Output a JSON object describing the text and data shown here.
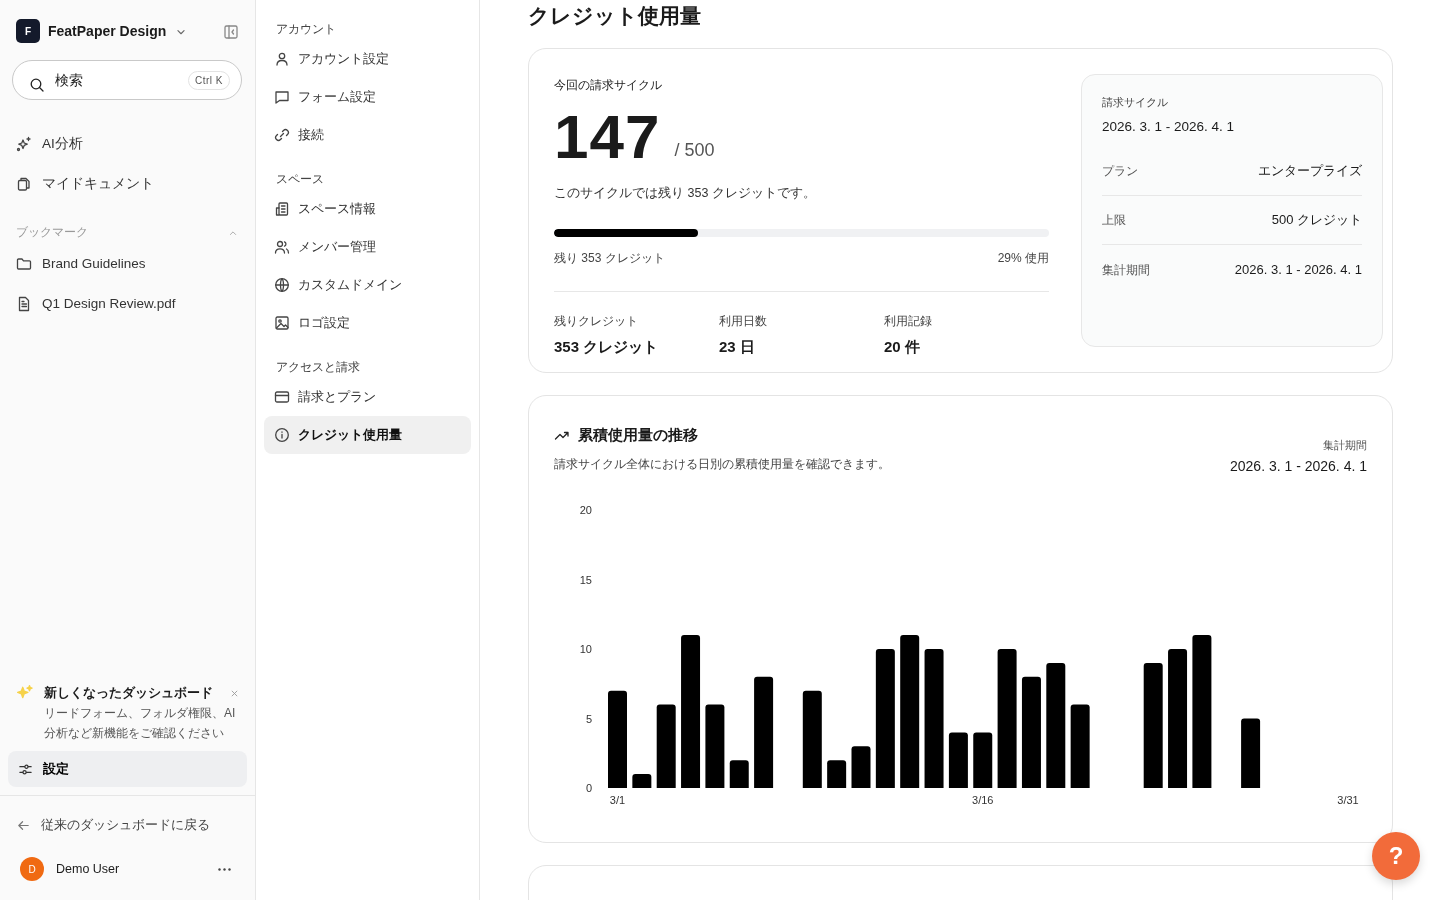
{
  "sidebar": {
    "workspace": {
      "initial": "F",
      "name": "FeatPaper Design"
    },
    "search": {
      "placeholder": "検索",
      "shortcut": "Ctrl K"
    },
    "nav": [
      {
        "label": "AI分析"
      },
      {
        "label": "マイドキュメント"
      }
    ],
    "bookmarks": {
      "title": "ブックマーク",
      "expanded": true,
      "items": [
        {
          "label": "Brand Guidelines"
        },
        {
          "label": "Q1 Design Review.pdf"
        }
      ]
    },
    "notice": {
      "title": "新しくなったダッシュボード",
      "body": "リードフォーム、フォルダ権限、AI分析など新機能をご確認ください"
    },
    "settings": {
      "label": "設定",
      "selected": true
    },
    "back": "従来のダッシュボードに戻る",
    "user": {
      "initial": "D",
      "name": "Demo User"
    }
  },
  "settings_nav": [
    {
      "title": "アカウント",
      "items": [
        {
          "label": "アカウント設定",
          "selected": false
        },
        {
          "label": "フォーム設定",
          "selected": false
        },
        {
          "label": "接続",
          "selected": false
        }
      ]
    },
    {
      "title": "スペース",
      "items": [
        {
          "label": "スペース情報",
          "selected": false
        },
        {
          "label": "メンバー管理",
          "selected": false
        },
        {
          "label": "カスタムドメイン",
          "selected": false
        },
        {
          "label": "ロゴ設定",
          "selected": false
        }
      ]
    },
    {
      "title": "アクセスと請求",
      "items": [
        {
          "label": "請求とプラン",
          "selected": false
        },
        {
          "label": "クレジット使用量",
          "selected": true
        }
      ]
    }
  ],
  "main": {
    "title": "クレジット使用量",
    "usage": {
      "label": "今回の請求サイクル",
      "used": "147",
      "total": "/ 500",
      "message": "このサイクルでは残り 353 クレジットです。",
      "level": 0.29,
      "remaining": "残り 353 クレジット",
      "percent": "29% 使用",
      "stats": [
        {
          "label": "残りクレジット",
          "value": "353 クレジット"
        },
        {
          "label": "利用日数",
          "value": "23 日"
        },
        {
          "label": "利用記録",
          "value": "20 件"
        }
      ]
    },
    "details": {
      "cycle_label": "請求サイクル",
      "cycle_value": "2026. 3. 1 - 2026. 4. 1",
      "rows": [
        {
          "label": "プラン",
          "value": "エンタープライズ"
        },
        {
          "label": "上限",
          "value": "500 クレジット"
        },
        {
          "label": "集計期間",
          "value": "2026. 3. 1 - 2026. 4. 1"
        }
      ]
    },
    "trend": {
      "title": "累積使用量の推移",
      "subtitle": "請求サイクル全体における日別の累積使用量を確認できます。",
      "period_label": "集計期間",
      "period_value": "2026. 3. 1 - 2026. 4. 1",
      "chart_data": {
        "type": "bar",
        "categories": [
          "3/1",
          null,
          null,
          null,
          null,
          null,
          null,
          null,
          null,
          null,
          null,
          null,
          null,
          null,
          null,
          "3/16",
          null,
          null,
          null,
          null,
          null,
          null,
          null,
          null,
          null,
          null,
          null,
          null,
          null,
          null,
          "3/31"
        ],
        "values": [
          7,
          1,
          6,
          11,
          6,
          2,
          8,
          0,
          7,
          2,
          3,
          10,
          11,
          10,
          4,
          4,
          10,
          8,
          9,
          6,
          0,
          0,
          9,
          10,
          11,
          0,
          5,
          0,
          0,
          0,
          0
        ],
        "ylim": [
          0,
          20
        ],
        "yticks": [
          0,
          5,
          10,
          15,
          20
        ]
      }
    }
  },
  "help": {
    "label": "?"
  }
}
